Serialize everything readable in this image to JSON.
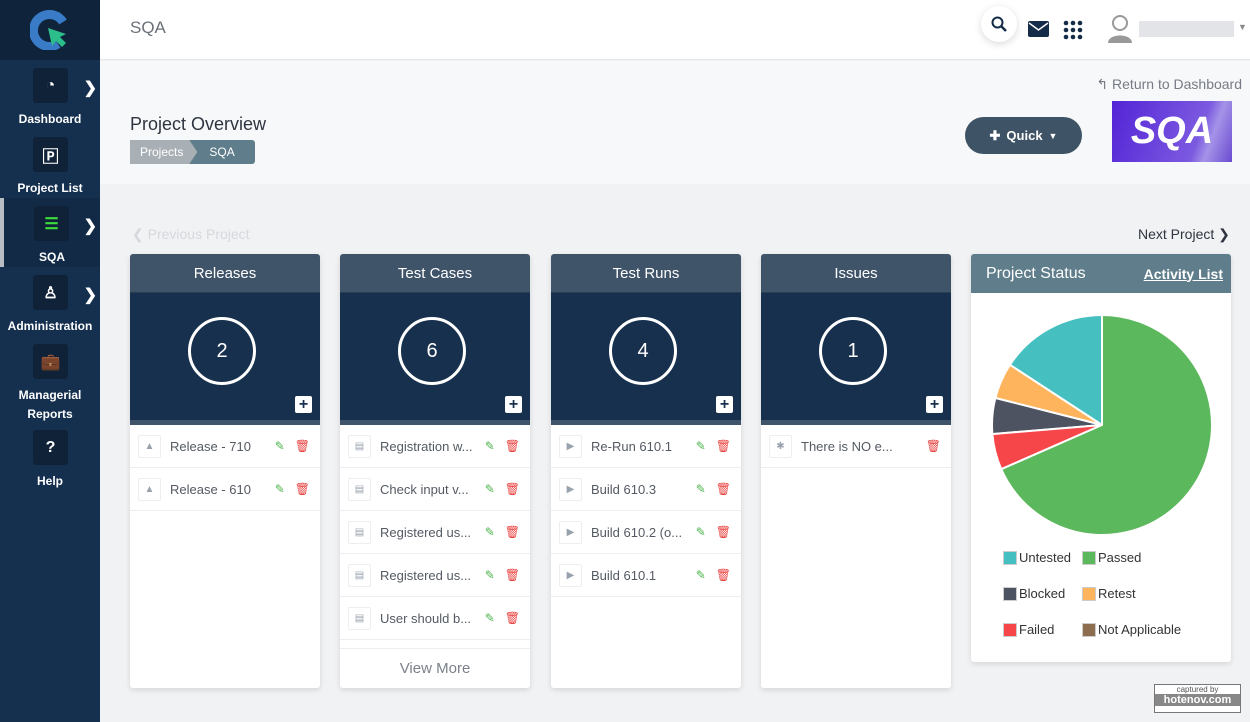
{
  "header": {
    "title": "SQA"
  },
  "sidebar": {
    "items": [
      {
        "label": "Dashboard",
        "icon": "gauge-icon",
        "glyph": "◔",
        "chevron": true
      },
      {
        "label": "Project List",
        "icon": "project-file-icon",
        "glyph": "🄿",
        "chevron": false
      },
      {
        "label": "SQA",
        "icon": "list-icon",
        "glyph": "☰",
        "chevron": true,
        "active": true
      },
      {
        "label": "Administration",
        "icon": "admin-user-icon",
        "glyph": "♙",
        "chevron": true
      },
      {
        "label": "Managerial Reports",
        "icon": "briefcase-icon",
        "glyph": "💼",
        "chevron": false
      },
      {
        "label": "Help",
        "icon": "help-icon",
        "glyph": "?",
        "chevron": false
      }
    ]
  },
  "page": {
    "return_label": "Return to Dashboard",
    "title": "Project Overview",
    "breadcrumb": [
      "Projects",
      "SQA"
    ],
    "quick_label": "Quick",
    "logo_text": "SQA",
    "prev_label": "Previous Project",
    "next_label": "Next Project"
  },
  "cards": [
    {
      "title": "Releases",
      "count": "2",
      "items": [
        "Release - 710",
        "Release - 610"
      ],
      "icon": "road-icon",
      "glyph": "▲"
    },
    {
      "title": "Test Cases",
      "count": "6",
      "items": [
        "Registration w...",
        "Check input v...",
        "Registered us...",
        "Registered us...",
        "User should b..."
      ],
      "icon": "document-icon",
      "glyph": "▤",
      "view_more": "View More"
    },
    {
      "title": "Test Runs",
      "count": "4",
      "items": [
        "Re-Run 610.1",
        "Build 610.3",
        "Build 610.2 (o...",
        "Build 610.1"
      ],
      "icon": "play-icon",
      "glyph": "▶"
    },
    {
      "title": "Issues",
      "count": "1",
      "items": [
        "There is NO e..."
      ],
      "icon": "bug-icon",
      "glyph": "✱",
      "no_edit": true
    }
  ],
  "status": {
    "title": "Project Status",
    "activity_link": "Activity List"
  },
  "chart_data": {
    "type": "pie",
    "start": "top",
    "direction": "counterclockwise",
    "slices": [
      {
        "name": "Untested",
        "value": 3,
        "color": "#45bfbf"
      },
      {
        "name": "Retest",
        "value": 1,
        "color": "#fdb45c"
      },
      {
        "name": "Blocked",
        "value": 1,
        "color": "#4d5360"
      },
      {
        "name": "Failed",
        "value": 1,
        "color": "#f7464a"
      },
      {
        "name": "Passed",
        "value": 13,
        "color": "#5cb85c"
      },
      {
        "name": "Not Applicable",
        "value": 0,
        "color": "#8c6e4f"
      }
    ],
    "legend": [
      "Untested",
      "Passed",
      "Blocked",
      "Retest",
      "Failed",
      "Not Applicable"
    ],
    "legend_position": "bottom"
  },
  "watermark": {
    "line1": "captured by",
    "line2": "hotenov.com"
  }
}
